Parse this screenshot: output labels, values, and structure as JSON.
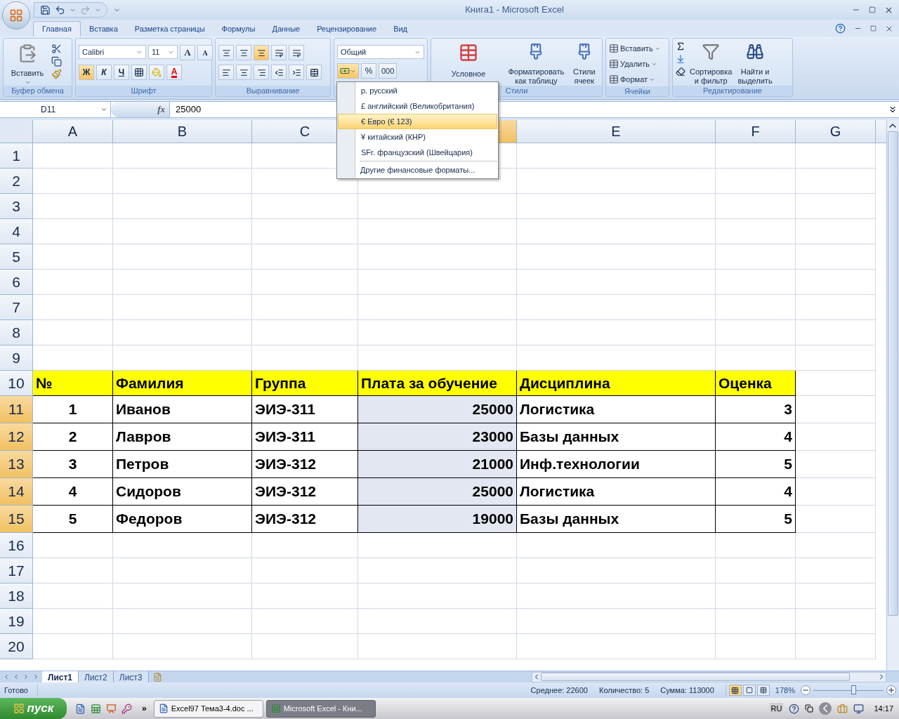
{
  "title_bar": {
    "title": "Книга1 - Microsoft Excel"
  },
  "ribbon_tabs": [
    {
      "label": "Главная",
      "selected": true
    },
    {
      "label": "Вставка",
      "selected": false
    },
    {
      "label": "Разметка страницы",
      "selected": false
    },
    {
      "label": "Формулы",
      "selected": false
    },
    {
      "label": "Данные",
      "selected": false
    },
    {
      "label": "Рецензирование",
      "selected": false
    },
    {
      "label": "Вид",
      "selected": false
    }
  ],
  "clipboard": {
    "paste": "Вставить",
    "label": "Буфер обмена"
  },
  "font": {
    "name": "Calibri",
    "size": "11",
    "bold": "Ж",
    "italic": "К",
    "underline": "Ч",
    "grow": "A",
    "shrink": "A",
    "color_letter": "A",
    "bold_active": true,
    "label": "Шрифт"
  },
  "alignment": {
    "bottom_align_active": true,
    "label": "Выравнивание"
  },
  "number": {
    "format": "Общий",
    "percent": "%",
    "thousands": "000",
    "currency_open": true
  },
  "styles": {
    "items": [
      {
        "lines": [
          "Условное"
        ]
      },
      {
        "lines": [
          "Форматировать",
          "как таблицу"
        ]
      },
      {
        "lines": [
          "Стили",
          "ячеек"
        ]
      }
    ],
    "label": "Стили"
  },
  "cells": {
    "items": [
      "Вставить",
      "Удалить",
      "Формат"
    ],
    "label": "Ячейки"
  },
  "editing": {
    "items": [
      {
        "lines": [
          "Сортировка",
          "и фильтр"
        ]
      },
      {
        "lines": [
          "Найти и",
          "выделить"
        ]
      }
    ],
    "label": "Редактирование"
  },
  "formula_bar": {
    "name_box": "D11",
    "fx": "fx",
    "value": "25000"
  },
  "columns": [
    {
      "label": "A",
      "selected": false
    },
    {
      "label": "B",
      "selected": false
    },
    {
      "label": "C",
      "selected": false
    },
    {
      "selected": true
    },
    {
      "label": "E",
      "selected": false
    },
    {
      "label": "F",
      "selected": false
    },
    {
      "label": "G",
      "selected": false
    }
  ],
  "rows": [
    {
      "number": "1",
      "selected": false,
      "kind": "empty"
    },
    {
      "number": "2",
      "selected": false,
      "kind": "empty"
    },
    {
      "number": "3",
      "selected": false,
      "kind": "empty"
    },
    {
      "number": "4",
      "selected": false,
      "kind": "empty"
    },
    {
      "number": "5",
      "selected": false,
      "kind": "empty"
    },
    {
      "number": "6",
      "selected": false,
      "kind": "empty"
    },
    {
      "number": "7",
      "selected": false,
      "kind": "empty"
    },
    {
      "number": "8",
      "selected": false,
      "kind": "empty"
    },
    {
      "number": "9",
      "selected": false,
      "kind": "empty"
    },
    {
      "number": "10",
      "selected": false,
      "kind": "header",
      "cells": [
        "№",
        "Фамилия",
        "Группа",
        "Плата за обучение",
        "Дисциплина",
        "Оценка"
      ]
    },
    {
      "number": "11",
      "selected": true,
      "kind": "data",
      "cells": [
        "1",
        "Иванов",
        "ЭИЭ-311",
        "25000",
        "Логистика",
        "3"
      ]
    },
    {
      "number": "12",
      "selected": true,
      "kind": "data",
      "cells": [
        "2",
        "Лавров",
        "ЭИЭ-311",
        "23000",
        "Базы данных",
        "4"
      ]
    },
    {
      "number": "13",
      "selected": true,
      "kind": "data",
      "cells": [
        "3",
        "Петров",
        "ЭИЭ-312",
        "21000",
        "Инф.технологии",
        "5"
      ]
    },
    {
      "number": "14",
      "selected": true,
      "kind": "data",
      "cells": [
        "4",
        "Сидоров",
        "ЭИЭ-312",
        "25000",
        "Логистика",
        "4"
      ]
    },
    {
      "number": "15",
      "selected": true,
      "kind": "data",
      "cells": [
        "5",
        "Федоров",
        "ЭИЭ-312",
        "19000",
        "Базы данных",
        "5"
      ]
    },
    {
      "number": "16",
      "selected": false,
      "kind": "empty"
    },
    {
      "number": "17",
      "selected": false,
      "kind": "empty"
    },
    {
      "number": "18",
      "selected": false,
      "kind": "empty"
    },
    {
      "number": "19",
      "selected": false,
      "kind": "empty"
    },
    {
      "number": "20",
      "selected": false,
      "kind": "empty"
    }
  ],
  "currency_menu": {
    "items": [
      {
        "label": "р. русский",
        "selected": false
      },
      {
        "label": "£ английский (Великобритания)",
        "selected": false
      },
      {
        "label": "€ Евро (€ 123)",
        "selected": true
      },
      {
        "label": "¥  китайский (КНР)",
        "selected": false
      },
      {
        "label": "SFr. французский (Швейцария)",
        "selected": false
      }
    ],
    "more": "Другие финансовые форматы..."
  },
  "sheet_tabs": [
    {
      "label": "Лист1",
      "selected": true
    },
    {
      "label": "Лист2",
      "selected": false
    },
    {
      "label": "Лист3",
      "selected": false
    }
  ],
  "status_bar": {
    "status": "Готово",
    "stats": [
      "Среднее: 22600",
      "Количество: 5",
      "Сумма: 113000"
    ],
    "view_buttons": [
      {
        "kind": "normal",
        "selected": true
      },
      {
        "kind": "layout",
        "selected": false
      },
      {
        "kind": "pagebreak",
        "selected": false
      }
    ],
    "zoom": {
      "label": "178%",
      "level": 0.58
    }
  },
  "taskbar": {
    "start": "пуск",
    "more": "»",
    "tasks": [
      {
        "label": "Excel97 Тема3-4.doc ...",
        "kind": "word",
        "selected": false
      },
      {
        "label": "Microsoft Excel - Кни...",
        "kind": "excel",
        "selected": true
      }
    ],
    "language": "RU",
    "time": "14:17"
  }
}
